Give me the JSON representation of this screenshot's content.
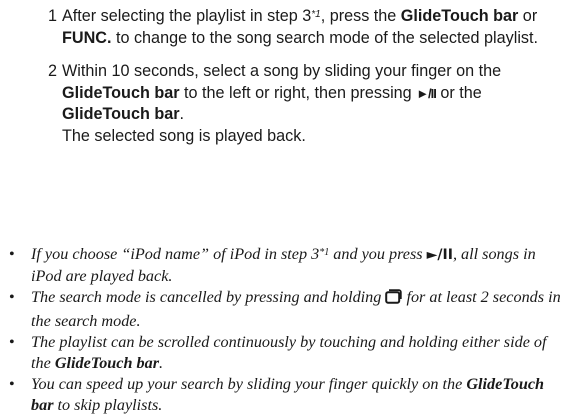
{
  "steps": [
    {
      "number": "1",
      "t1": "After selecting the playlist in step 3",
      "ref": "*1",
      "t2": ", press the ",
      "b1": "GlideTouch bar",
      "t3": " or ",
      "b2": "FUNC.",
      "t4": " to change to the song search mode of the selected playlist."
    },
    {
      "number": "2",
      "t1": "Within 10 seconds, select a song by sliding your finger on the ",
      "b1": "GlideTouch bar",
      "t2": " to the left or right, then pressing ",
      "play_glyph": "►/II",
      "t3": " or the ",
      "b2": "GlideTouch bar",
      "t4": ".",
      "continuation": "The selected song is played back."
    }
  ],
  "notes": [
    {
      "t1": "If you choose “iPod name” of iPod in step 3",
      "ref": "*1",
      "t2": " and you press ",
      "glyph": "►/II",
      "t3": ", all songs in iPod are played back."
    },
    {
      "t1": "The search mode is cancelled by pressing and holding ",
      "icon": "folder-icon",
      "t2": " for at least 2 seconds in the search mode."
    },
    {
      "t1": "The playlist can be scrolled continuously by touching and holding either side of the ",
      "b1": "GlideTouch bar",
      "t2": "."
    },
    {
      "t1": "You can speed up your search by sliding your finger quickly on the ",
      "b1": "GlideTouch bar",
      "t2": " to skip playlists."
    }
  ],
  "bullet": "•"
}
